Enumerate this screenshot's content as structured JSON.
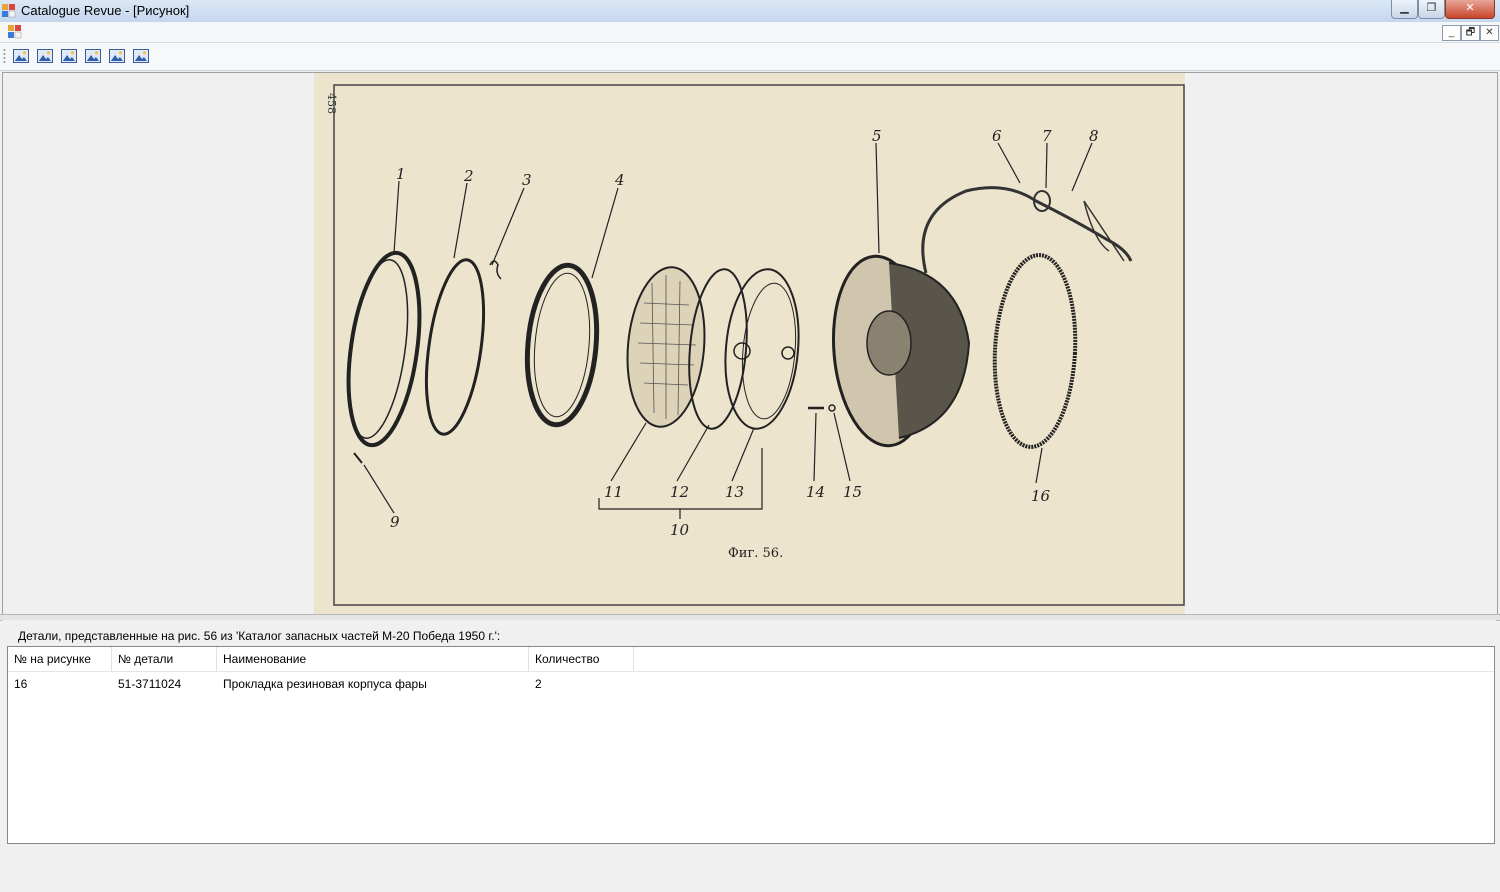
{
  "window": {
    "title": "Catalogue Revue - [Рисунок]",
    "controls": [
      "minimize",
      "maximize",
      "close"
    ]
  },
  "mdi": {
    "controls": [
      "minimize",
      "restore",
      "close"
    ]
  },
  "toolbar": {
    "buttons": [
      "picture-icon",
      "picture-icon",
      "picture-icon",
      "picture-icon",
      "picture-icon",
      "picture-icon"
    ]
  },
  "figure": {
    "page_number": "458",
    "caption": "Фиг. 56.",
    "callouts": [
      "1",
      "2",
      "3",
      "4",
      "5",
      "6",
      "7",
      "8",
      "9",
      "10",
      "11",
      "12",
      "13",
      "14",
      "15",
      "16"
    ]
  },
  "details": {
    "caption": "Детали, представленные на рис. 56 из 'Каталог запасных частей М-20 Победа 1950 г.':",
    "columns": [
      "№ на рисунке",
      "№ детали",
      "Наименование",
      "Количество"
    ],
    "rows": [
      [
        "16",
        "51-3711024",
        "Прокладка резиновая корпуса фары",
        "2"
      ]
    ]
  }
}
